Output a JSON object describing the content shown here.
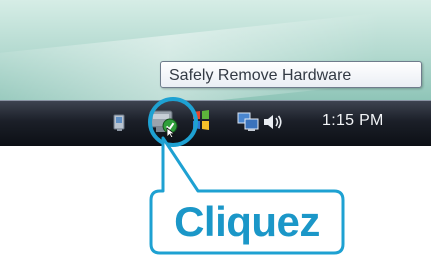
{
  "tooltip": {
    "text": "Safely Remove Hardware"
  },
  "taskbar": {
    "tray_icons": [
      "network-icon",
      "safely-remove-hardware-icon",
      "windows-flag-icon",
      "network-icon",
      "volume-icon"
    ],
    "clock": "1:15 PM"
  },
  "callout": {
    "label": "Cliquez"
  },
  "colors": {
    "accent": "#1ea1d2",
    "callout_text": "#1b97c8",
    "taskbar": "#1b1f28",
    "desktop": "#b2d9cf"
  }
}
